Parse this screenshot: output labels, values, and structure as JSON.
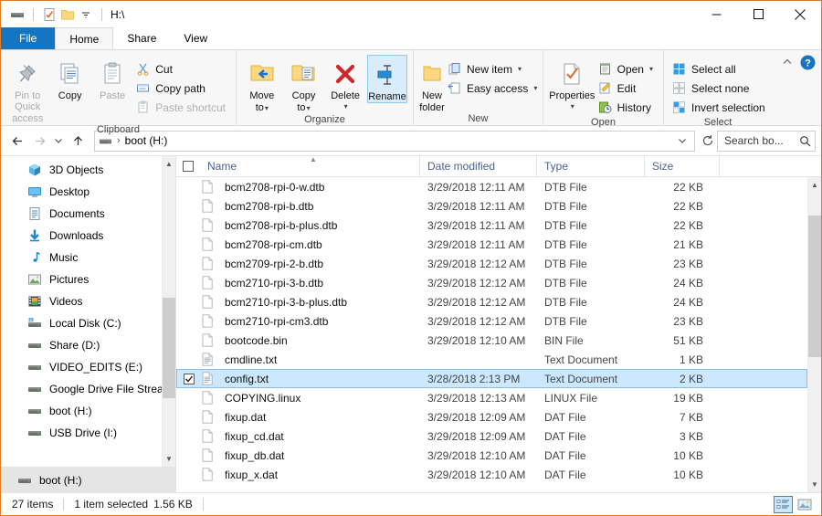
{
  "window": {
    "title_path": "H:\\",
    "quick_access_icons": [
      "drive-icon",
      "properties-icon",
      "new-folder-icon",
      "customize-qat-dropdown-icon"
    ],
    "controls": {
      "minimize": "minimize-icon",
      "maximize": "maximize-icon",
      "close": "close-icon"
    }
  },
  "tabs": [
    {
      "label": "File",
      "id": "file"
    },
    {
      "label": "Home",
      "id": "home"
    },
    {
      "label": "Share",
      "id": "share"
    },
    {
      "label": "View",
      "id": "view"
    }
  ],
  "active_tab": "Home",
  "ribbon": {
    "groups": [
      {
        "label": "Clipboard",
        "big": [
          {
            "label": "Pin to Quick\naccess",
            "line1": "Pin to Quick",
            "line2": "access",
            "icon": "pin-icon",
            "disabled": true
          },
          {
            "label": "Copy",
            "line1": "Copy",
            "line2": "",
            "icon": "copy-icon",
            "disabled": false
          },
          {
            "label": "Paste",
            "line1": "Paste",
            "line2": "",
            "icon": "paste-icon",
            "disabled": true
          }
        ],
        "small": [
          {
            "label": "Cut",
            "icon": "scissors-icon",
            "disabled": false,
            "caret": false
          },
          {
            "label": "Copy path",
            "icon": "copy-path-icon",
            "disabled": false,
            "caret": false
          },
          {
            "label": "Paste shortcut",
            "icon": "paste-shortcut-icon",
            "disabled": true,
            "caret": false
          }
        ]
      },
      {
        "label": "Organize",
        "big": [
          {
            "line1": "Move",
            "line2": "to",
            "icon": "move-to-icon",
            "caret": true,
            "disabled": false
          },
          {
            "line1": "Copy",
            "line2": "to",
            "icon": "copy-to-icon",
            "caret": true,
            "disabled": false
          },
          {
            "line1": "Delete",
            "line2": "",
            "icon": "delete-icon",
            "caret": true,
            "disabled": false
          },
          {
            "line1": "Rename",
            "line2": "",
            "icon": "rename-icon",
            "caret": false,
            "disabled": false,
            "selected": true
          }
        ],
        "small": []
      },
      {
        "label": "New",
        "big": [
          {
            "line1": "New",
            "line2": "folder",
            "icon": "new-folder-icon",
            "disabled": false
          }
        ],
        "small": [
          {
            "label": "New item",
            "icon": "new-item-icon",
            "disabled": false,
            "caret": true
          },
          {
            "label": "Easy access",
            "icon": "easy-access-icon",
            "disabled": false,
            "caret": true
          }
        ]
      },
      {
        "label": "Open",
        "big": [
          {
            "line1": "Properties",
            "line2": "",
            "icon": "properties-icon",
            "caret": true,
            "disabled": false
          }
        ],
        "small": [
          {
            "label": "Open",
            "icon": "open-icon",
            "disabled": false,
            "caret": true
          },
          {
            "label": "Edit",
            "icon": "edit-icon",
            "disabled": false,
            "caret": false
          },
          {
            "label": "History",
            "icon": "history-icon",
            "disabled": false,
            "caret": false
          }
        ]
      },
      {
        "label": "Select",
        "big": [],
        "small": [
          {
            "label": "Select all",
            "icon": "select-all-icon",
            "disabled": false,
            "caret": false
          },
          {
            "label": "Select none",
            "icon": "select-none-icon",
            "disabled": false,
            "caret": false
          },
          {
            "label": "Invert selection",
            "icon": "invert-selection-icon",
            "disabled": false,
            "caret": false
          }
        ]
      }
    ],
    "collapse_icon": "chevron-up-icon",
    "help_icon": "help-icon"
  },
  "address": {
    "back_icon": "arrow-left-icon",
    "forward_icon": "arrow-right-icon",
    "recent_icon": "chevron-down-icon",
    "up_icon": "arrow-up-icon",
    "crumb_icon": "drive-icon",
    "crumb_sep": "›",
    "crumb_text": "boot (H:)",
    "dropdown_icon": "chevron-down-icon",
    "refresh_icon": "refresh-icon",
    "search_placeholder": "Search bo...",
    "search_value": "",
    "search_icon": "search-icon"
  },
  "navpane": {
    "items": [
      {
        "label": "3D Objects",
        "icon": "3d-objects-icon"
      },
      {
        "label": "Desktop",
        "icon": "desktop-icon"
      },
      {
        "label": "Documents",
        "icon": "documents-icon"
      },
      {
        "label": "Downloads",
        "icon": "downloads-icon"
      },
      {
        "label": "Music",
        "icon": "music-icon"
      },
      {
        "label": "Pictures",
        "icon": "pictures-icon"
      },
      {
        "label": "Videos",
        "icon": "videos-icon"
      },
      {
        "label": "Local Disk (C:)",
        "icon": "local-disk-icon"
      },
      {
        "label": "Share (D:)",
        "icon": "drive-icon"
      },
      {
        "label": "VIDEO_EDITS (E:)",
        "icon": "drive-icon"
      },
      {
        "label": "Google Drive File Stream (",
        "icon": "drive-icon"
      },
      {
        "label": "boot (H:)",
        "icon": "drive-icon"
      },
      {
        "label": "USB Drive (I:)",
        "icon": "drive-icon"
      }
    ],
    "bottom_item": {
      "label": "boot (H:)",
      "icon": "drive-icon"
    }
  },
  "columns": [
    {
      "label": "Name",
      "sorted": true
    },
    {
      "label": "Date modified",
      "sorted": false
    },
    {
      "label": "Type",
      "sorted": false
    },
    {
      "label": "Size",
      "sorted": false
    }
  ],
  "files": [
    {
      "name": "bcm2708-rpi-0-w.dtb",
      "date": "3/29/2018 12:11 AM",
      "type": "DTB File",
      "size": "22 KB",
      "icon": "file-icon",
      "selected": false
    },
    {
      "name": "bcm2708-rpi-b.dtb",
      "date": "3/29/2018 12:11 AM",
      "type": "DTB File",
      "size": "22 KB",
      "icon": "file-icon",
      "selected": false
    },
    {
      "name": "bcm2708-rpi-b-plus.dtb",
      "date": "3/29/2018 12:11 AM",
      "type": "DTB File",
      "size": "22 KB",
      "icon": "file-icon",
      "selected": false
    },
    {
      "name": "bcm2708-rpi-cm.dtb",
      "date": "3/29/2018 12:11 AM",
      "type": "DTB File",
      "size": "21 KB",
      "icon": "file-icon",
      "selected": false
    },
    {
      "name": "bcm2709-rpi-2-b.dtb",
      "date": "3/29/2018 12:12 AM",
      "type": "DTB File",
      "size": "23 KB",
      "icon": "file-icon",
      "selected": false
    },
    {
      "name": "bcm2710-rpi-3-b.dtb",
      "date": "3/29/2018 12:12 AM",
      "type": "DTB File",
      "size": "24 KB",
      "icon": "file-icon",
      "selected": false
    },
    {
      "name": "bcm2710-rpi-3-b-plus.dtb",
      "date": "3/29/2018 12:12 AM",
      "type": "DTB File",
      "size": "24 KB",
      "icon": "file-icon",
      "selected": false
    },
    {
      "name": "bcm2710-rpi-cm3.dtb",
      "date": "3/29/2018 12:12 AM",
      "type": "DTB File",
      "size": "23 KB",
      "icon": "file-icon",
      "selected": false
    },
    {
      "name": "bootcode.bin",
      "date": "3/29/2018 12:10 AM",
      "type": "BIN File",
      "size": "51 KB",
      "icon": "file-icon",
      "selected": false
    },
    {
      "name": "cmdline.txt",
      "date": "",
      "type": "Text Document",
      "size": "1 KB",
      "icon": "text-file-icon",
      "selected": false
    },
    {
      "name": "config.txt",
      "date": "3/28/2018 2:13 PM",
      "type": "Text Document",
      "size": "2 KB",
      "icon": "text-file-icon",
      "selected": true
    },
    {
      "name": "COPYING.linux",
      "date": "3/29/2018 12:13 AM",
      "type": "LINUX File",
      "size": "19 KB",
      "icon": "file-icon",
      "selected": false
    },
    {
      "name": "fixup.dat",
      "date": "3/29/2018 12:09 AM",
      "type": "DAT File",
      "size": "7 KB",
      "icon": "file-icon",
      "selected": false
    },
    {
      "name": "fixup_cd.dat",
      "date": "3/29/2018 12:09 AM",
      "type": "DAT File",
      "size": "3 KB",
      "icon": "file-icon",
      "selected": false
    },
    {
      "name": "fixup_db.dat",
      "date": "3/29/2018 12:10 AM",
      "type": "DAT File",
      "size": "10 KB",
      "icon": "file-icon",
      "selected": false
    },
    {
      "name": "fixup_x.dat",
      "date": "3/29/2018 12:10 AM",
      "type": "DAT File",
      "size": "10 KB",
      "icon": "file-icon",
      "selected": false
    }
  ],
  "statusbar": {
    "item_count": "27 items",
    "selection": "1 item selected",
    "selection_size": "1.56 KB",
    "details_view_icon": "details-view-icon",
    "large_icons_view_icon": "large-icons-view-icon"
  },
  "colors": {
    "accent": "#1675c0",
    "selection": "#cce8ff",
    "window_border": "#e07b28",
    "header_text": "#46648e"
  }
}
